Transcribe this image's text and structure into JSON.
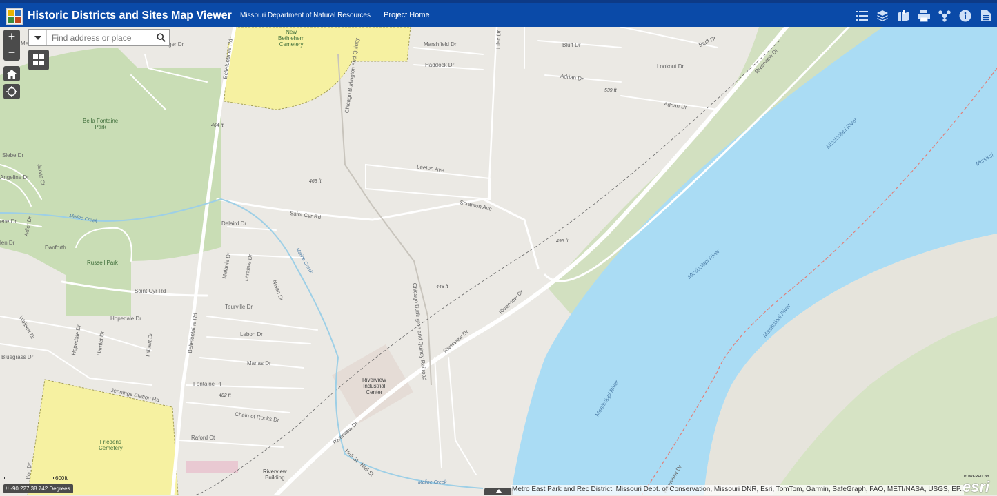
{
  "header": {
    "title": "Historic Districts and Sites Map Viewer",
    "dept_link": "Missouri Department of Natural Resources",
    "project_link": "Project Home",
    "tools": [
      {
        "icon": "legend-list-icon"
      },
      {
        "icon": "layers-icon"
      },
      {
        "icon": "bookmarks-icon"
      },
      {
        "icon": "print-icon"
      },
      {
        "icon": "share-icon"
      },
      {
        "icon": "info-icon"
      },
      {
        "icon": "document-icon"
      }
    ]
  },
  "map_controls": {
    "zoom_in": "+",
    "zoom_out": "−",
    "search_placeholder": "Find address or place"
  },
  "map_labels": {
    "new_bethlehem": "New\nBethlehem\nCemetery",
    "marshfield": "Marshfield Dr",
    "haddock": "Haddock Dr",
    "lilac": "Lilac Dr",
    "bluff_dr_1": "Bluff Dr",
    "bluff_dr_2": "Bluff Dr",
    "lookout": "Lookout Dr",
    "adrian_1": "Adrian Dr",
    "adrian_2": "Adrian Dr",
    "riverview_top": "Riverview Dr",
    "elev_539": "539 ft",
    "leeton": "Leeton Ave",
    "scranton": "Scranton Ave",
    "bellefontaine_top": "Bellefontaine Rd",
    "chicago_top": "Chicago Burlington and Quincy",
    "ger_dr": "ger Dr",
    "mea": "Mea",
    "elev_464": "464 ft",
    "bella_fontaine": "Bella Fontaine\nPark",
    "slebe": "Slebe Dr",
    "jarvis": "Jarvis Ct",
    "angeline": "Angeline Dr",
    "elev_463": "463 ft",
    "saint_cyr_top": "Saint Cyr Rd",
    "maline_creek_1": "Maline Creek",
    "ene": "ene Dr",
    "adler": "Adler Dr",
    "len": "len Dr",
    "danforth": "Danforth",
    "russell": "Russell Park",
    "delaird": "Delaird Dr",
    "melanie": "Melanie Dr",
    "laramie": "Laramie Dr",
    "nelan": "Nelan Dr",
    "maline_creek_2": "Maline Creek",
    "elev_495": "495 ft",
    "elev_448": "448 ft",
    "chicago_bottom": "Chicago Burlington and Quincy Railroad",
    "saint_cyr_bottom": "Saint Cyr Rd",
    "teurville": "Teurville Dr",
    "hopedale_1": "Hopedale Dr",
    "hopedale_2": "Hopedale Dr",
    "hamlet": "Hamlet Dr",
    "fillbert": "Fillbert Dr",
    "walbert": "Walbert Dr",
    "bluegrass": "Bluegrass Dr",
    "lebon": "Lebon Dr",
    "marias": "Marias Dr",
    "bellefontaine_bottom": "Bellefontaine Rd",
    "fontaine_pl": "Fontaine Pl",
    "elev_482": "482 ft",
    "jennings": "Jennings Station Rd",
    "chain_of_rocks": "Chain of Rocks Dr",
    "raford": "Raford Ct",
    "friedens": "Friedens\nCemetery",
    "riverview_industrial": "Riverview\nIndustrial\nCenter",
    "riverview_dr_1": "Riverview Dr",
    "riverview_dr_2": "Riverview Dr",
    "riverview_dr_3": "Riverview Dr",
    "hall_st": "Hall St",
    "hall_st_2": "Hall St",
    "riverview_building": "Riverview\nBuilding",
    "maline_creek_3": "Maline Creek",
    "mississippi_1": "Mississippi River",
    "mississippi_2": "Mississippi River",
    "mississippi_3": "Mississippi River",
    "mississippi_4": "Mississippi River",
    "mississippi_edge": "Mississi",
    "riverview_bottom_right": "Riverview Dr",
    "lfort": "lfort Dr"
  },
  "scalebar": {
    "label": "600ft"
  },
  "coordinates": "-90.227 38.742 Degrees",
  "attribution": "Metro East Park and Rec District, Missouri Dept. of Conservation, Missouri DNR, Esri, TomTom, Garmin, SafeGraph, FAO, METI/NASA, USGS, EP...",
  "esri": {
    "powered_by": "POWERED BY",
    "logo": "esri"
  },
  "colors": {
    "header_bg": "#0a4aa8",
    "river": "#a9dcf5",
    "historic_district": "#f5f0a0",
    "park": "#c8dcb4",
    "land": "#eceae6"
  }
}
